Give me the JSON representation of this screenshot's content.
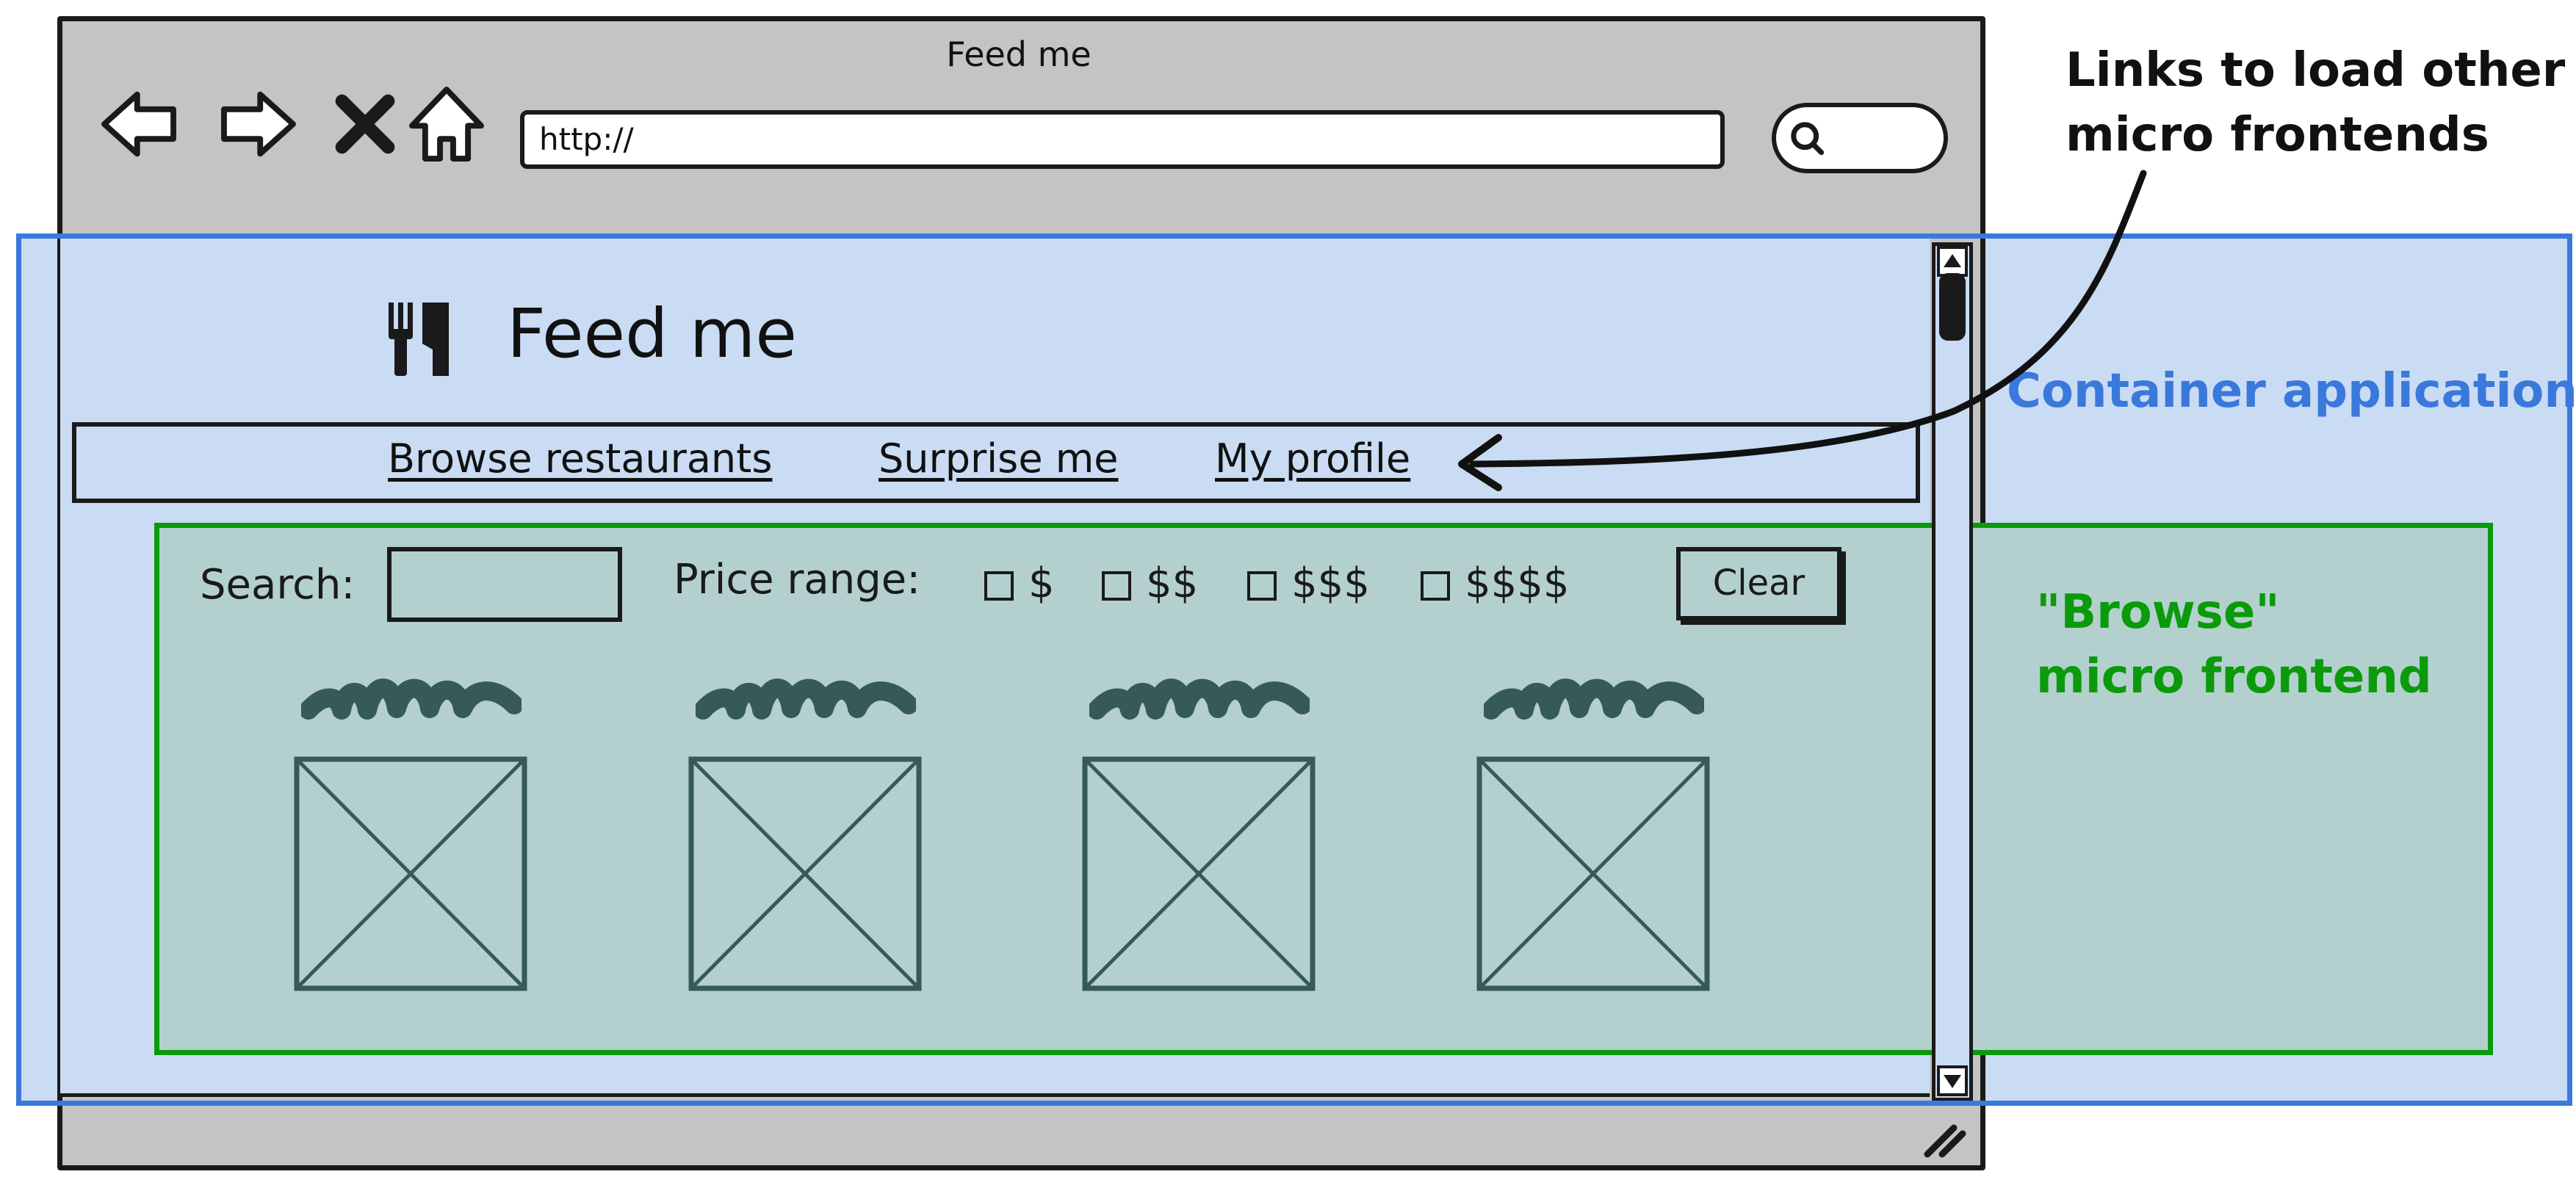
{
  "browser": {
    "title": "Feed me",
    "address": "http://"
  },
  "app": {
    "title": "Feed me",
    "nav_links": [
      "Browse restaurants",
      "Surprise me",
      "My profile"
    ]
  },
  "browse": {
    "search_label": "Search:",
    "price_label": "Price range:",
    "price_options": [
      "$",
      "$$",
      "$$$",
      "$$$$"
    ],
    "clear_label": "Clear"
  },
  "annotations": {
    "links_line1": "Links to load other",
    "links_line2": "micro frontends",
    "container": "Container application",
    "browse_line1": "\"Browse\"",
    "browse_line2": "micro frontend"
  },
  "colors": {
    "container_boundary": "#3a78dc",
    "browse_boundary": "#0a9a0a",
    "container_fill": "#c9dcf4",
    "browse_fill": "#b3d0ce"
  }
}
